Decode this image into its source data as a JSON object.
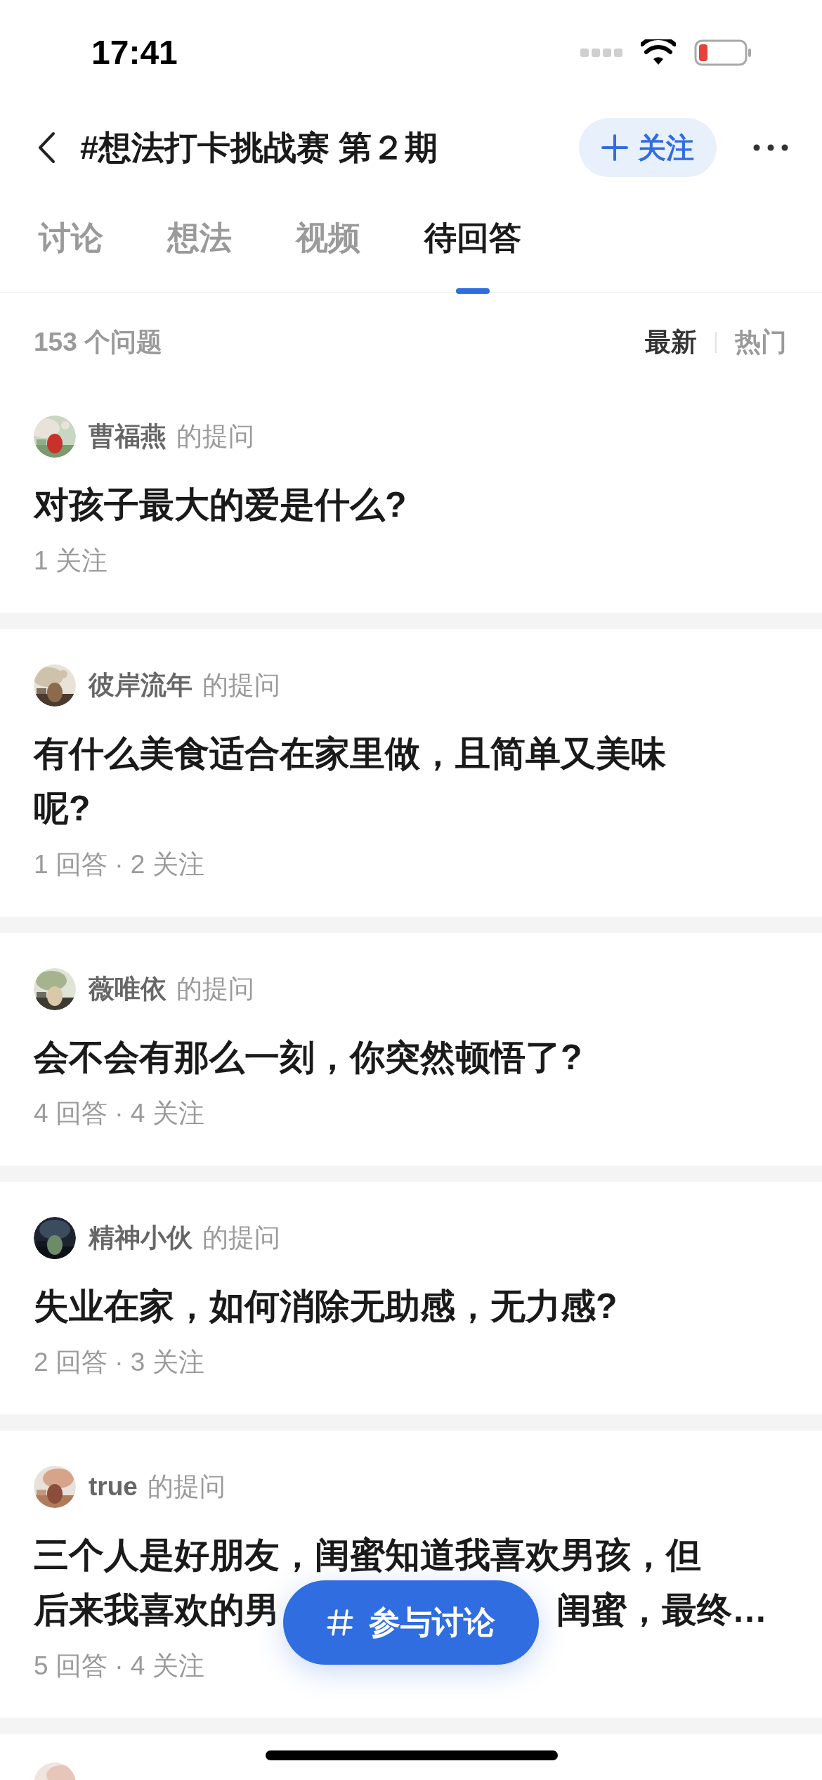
{
  "status_bar": {
    "time": "17:41"
  },
  "header": {
    "title": "#想法打卡挑战赛 第２期",
    "follow_button": "关注"
  },
  "tabs": [
    {
      "label": "讨论",
      "selected": false
    },
    {
      "label": "想法",
      "selected": false
    },
    {
      "label": "视频",
      "selected": false
    },
    {
      "label": "待回答",
      "selected": true
    }
  ],
  "list_header": {
    "count": "153 个问题",
    "sort_options": [
      {
        "label": "最新",
        "selected": true
      },
      {
        "label": "热门",
        "selected": false
      }
    ]
  },
  "questions": [
    {
      "author": "曹福燕",
      "action": "的提问",
      "title_lines": [
        [
          "对孩子最大的爱是什么?"
        ]
      ],
      "meta": "1 关注"
    },
    {
      "author": "彼岸流年",
      "action": "的提问",
      "title_lines": [
        [
          "有什么美食适合在家里做，且简单又美味"
        ],
        [
          "呢?"
        ]
      ],
      "meta": "1 回答 · 2 关注"
    },
    {
      "author": "薇唯依",
      "action": "的提问",
      "title_lines": [
        [
          "会不会有那么一刻，你突然顿悟了?"
        ]
      ],
      "meta": "4 回答 · 4 关注"
    },
    {
      "author": "精神小伙",
      "action": "的提问",
      "title_lines": [
        [
          "失业在家，如何消除无助感，无力感?"
        ]
      ],
      "meta": "2 回答 · 3 关注"
    },
    {
      "author": "true",
      "action": "的提问",
      "title_lines": [
        [
          "三个人是好朋友，闺蜜知道我喜欢男孩，但"
        ],
        [
          "后来我喜欢的男",
          "闺蜜，最终…"
        ]
      ],
      "meta": "5 回答 · 4 关注"
    }
  ],
  "fab": {
    "label": "参与讨论"
  }
}
